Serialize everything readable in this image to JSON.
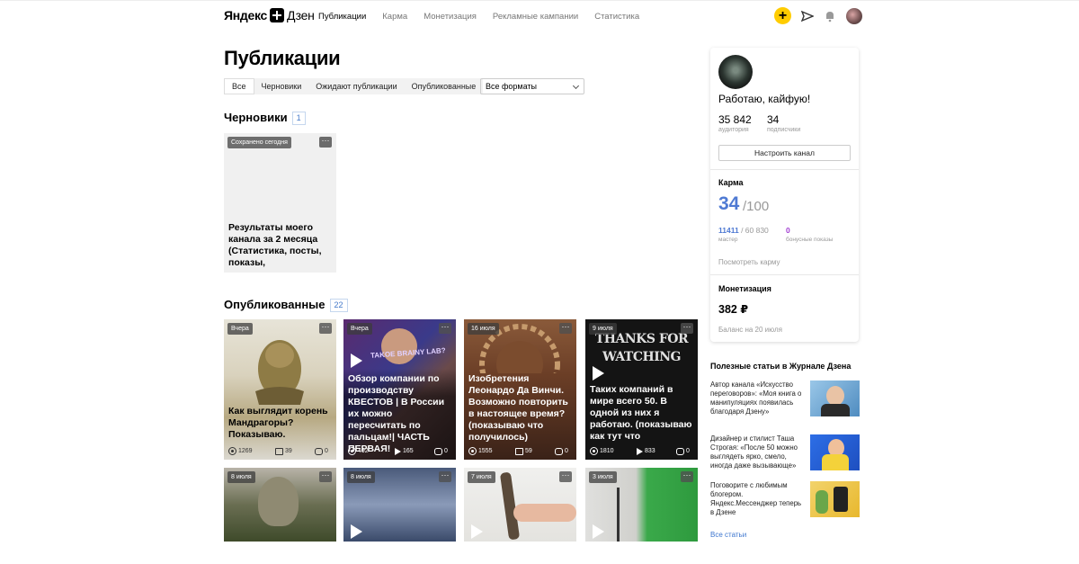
{
  "header": {
    "logo_brand": "Яндекс",
    "logo_product": "Дзен",
    "nav": [
      {
        "label": "Публикации",
        "active": true
      },
      {
        "label": "Карма",
        "active": false
      },
      {
        "label": "Монетизация",
        "active": false
      },
      {
        "label": "Рекламные кампании",
        "active": false
      },
      {
        "label": "Статистика",
        "active": false
      }
    ],
    "plus_label": "+",
    "accent_color": "#ffcc00"
  },
  "page": {
    "title": "Публикации",
    "tabs": [
      "Все",
      "Черновики",
      "Ожидают публикации",
      "Опубликованные"
    ],
    "active_tab": "Все",
    "format_select": "Все форматы"
  },
  "drafts": {
    "title": "Черновики",
    "count": "1",
    "items": [
      {
        "chip": "Сохранено сегодня",
        "title": "Результаты моего канала за 2 месяца (Статистика, посты, показы,"
      }
    ]
  },
  "published": {
    "title": "Опубликованные",
    "count": "22",
    "cards": [
      {
        "date": "Вчера",
        "title": "Как выглядит корень Мандрагоры? Показываю.",
        "views": "1269",
        "reads": "39",
        "comments": "0",
        "kind": "article"
      },
      {
        "date": "Вчера",
        "title": "Обзор компании по производству КВЕСТОВ | В России их можно пересчитать по пальцам!| ЧАСТЬ ПЕРВАЯ!",
        "views": "492",
        "reads": "165",
        "comments": "0",
        "kind": "video",
        "overlay_text": "TAKOE BRAINY LAB?"
      },
      {
        "date": "16 июля",
        "title": "Изобретения Леонардо Да Винчи. Возможно повторить в настоящее время? (показываю что получилось)",
        "views": "1555",
        "reads": "59",
        "comments": "0",
        "kind": "article"
      },
      {
        "date": "9 июля",
        "title": "Таких компаний в мире всего 50. В одной из них я работаю. (показываю как тут что",
        "views": "1810",
        "reads": "833",
        "comments": "0",
        "kind": "video",
        "overlay_text": "THANKS FOR WATCHING"
      },
      {
        "date": "8 июля",
        "kind": "article"
      },
      {
        "date": "8 июля",
        "kind": "video"
      },
      {
        "date": "7 июля",
        "kind": "video"
      },
      {
        "date": "3 июля",
        "kind": "video"
      }
    ]
  },
  "channel": {
    "name": "Работаю, кайфую!",
    "audience": "35 842",
    "audience_label": "аудитория",
    "subscribers": "34",
    "subscribers_label": "подписчики",
    "settings_button": "Настроить канал"
  },
  "karma": {
    "title": "Карма",
    "value": "34",
    "max": "/100",
    "mastery_value": "11411",
    "mastery_total": " / 60 830",
    "mastery_label": "мастер",
    "bonus_value": "0",
    "bonus_label": "бонусные показы",
    "link": "Посмотреть карму",
    "color": "#4f7ad3"
  },
  "monetization": {
    "title": "Монетизация",
    "amount": "382 ₽",
    "balance_note": "Баланс на 20 июля"
  },
  "useful": {
    "title": "Полезные статьи в Журнале Дзена",
    "items": [
      "Автор канала «Искусство переговоров»: «Моя книга о манипуляциях появилась благодаря Дзену»",
      "Дизайнер и стилист Таша Строгая: «После 50 можно выглядеть ярко, смело, иногда даже вызывающе»",
      "Поговорите с любимым блогером. Яндекс.Мессенджер теперь в Дзене"
    ],
    "all_link": "Все статьи"
  }
}
